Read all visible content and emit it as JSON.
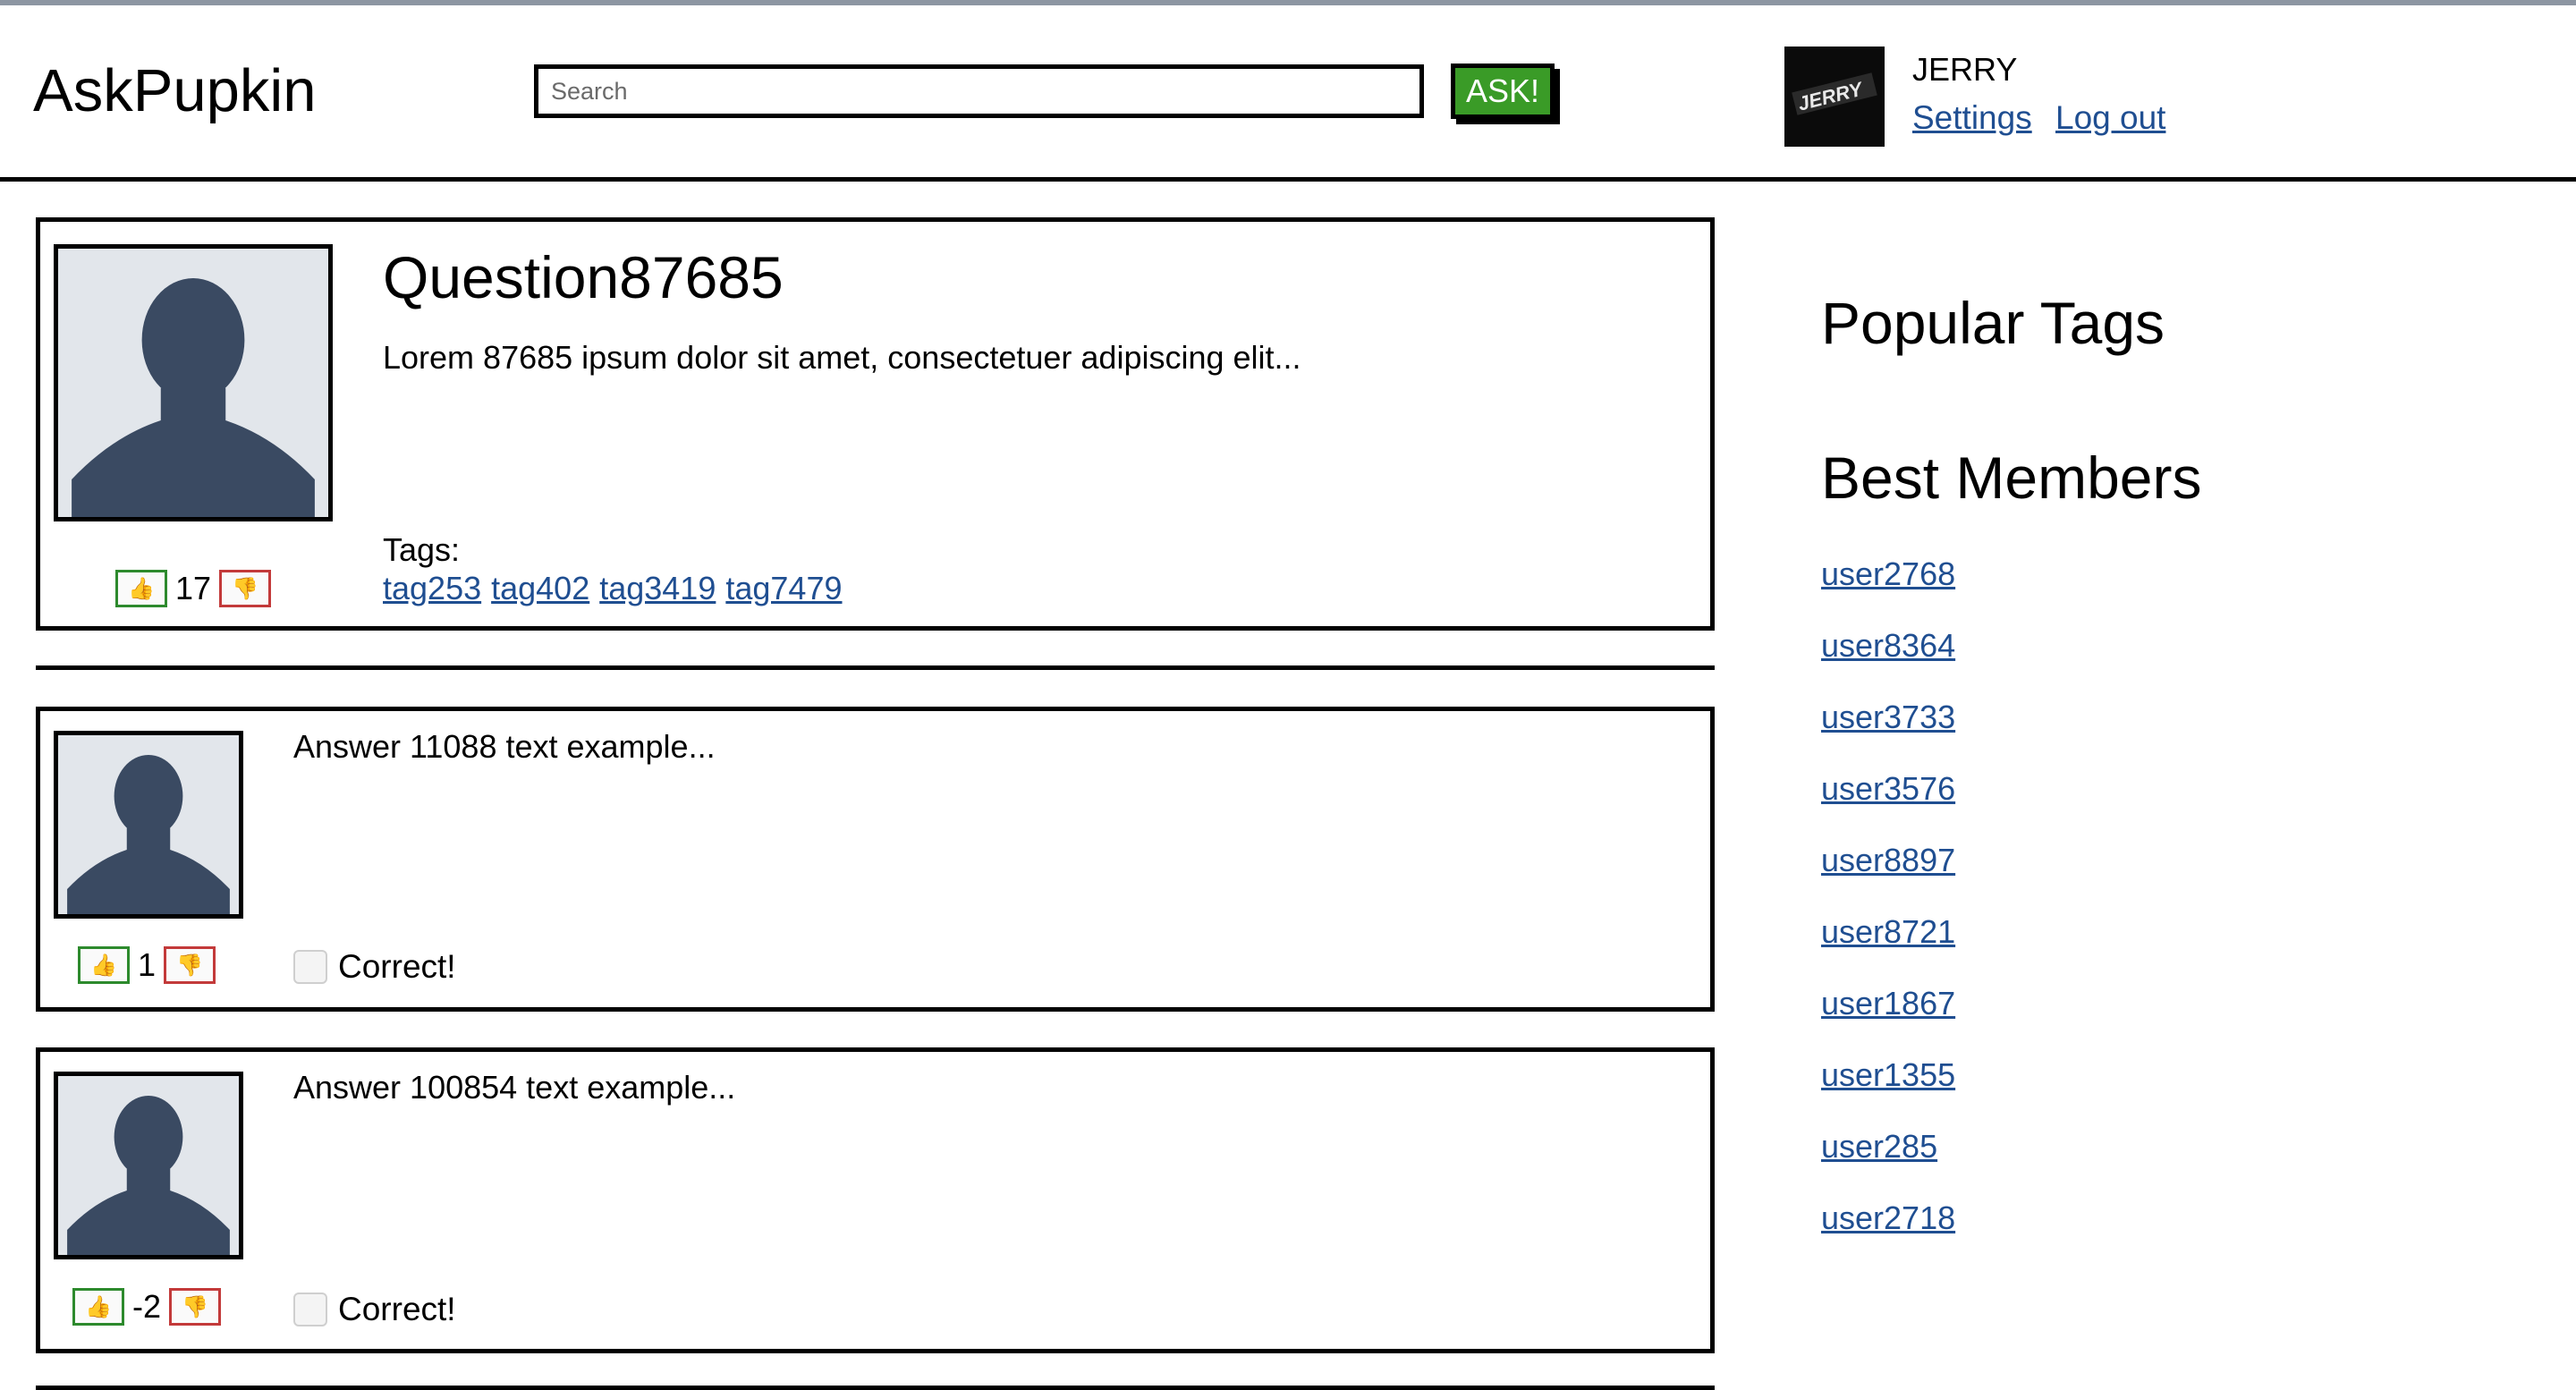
{
  "header": {
    "logo": "AskPupkin",
    "search_placeholder": "Search",
    "search_value": "",
    "ask_label": "ASK!",
    "username": "JERRY",
    "settings_label": "Settings",
    "logout_label": "Log out"
  },
  "question": {
    "title": "Question87685",
    "text": "Lorem 87685 ipsum dolor sit amet, consectetuer adipiscing elit...",
    "tags_label": "Tags:",
    "tags": [
      "tag253",
      "tag402",
      "tag3419",
      "tag7479"
    ],
    "votes": "17"
  },
  "answers": [
    {
      "text": "Answer 11088 text example...",
      "votes": "1",
      "correct_label": "Correct!",
      "checked": false
    },
    {
      "text": "Answer 100854 text example...",
      "votes": "-2",
      "correct_label": "Correct!",
      "checked": false
    }
  ],
  "sidebar": {
    "popular_tags_title": "Popular Tags",
    "best_members_title": "Best Members",
    "members": [
      "user2768",
      "user8364",
      "user3733",
      "user3576",
      "user8897",
      "user8721",
      "user1867",
      "user1355",
      "user285",
      "user2718"
    ]
  },
  "icons": {
    "vote_up": "thumbs-up-icon",
    "vote_down": "thumbs-down-icon",
    "avatar_placeholder": "person-silhouette-icon"
  },
  "colors": {
    "ask_button": "#3a9b27",
    "link": "#1f4e91",
    "vote_up_border": "#2d8a2d",
    "vote_down_border": "#c33a3a",
    "avatar_bg": "#e2e6eb",
    "silhouette": "#3a4a62"
  }
}
